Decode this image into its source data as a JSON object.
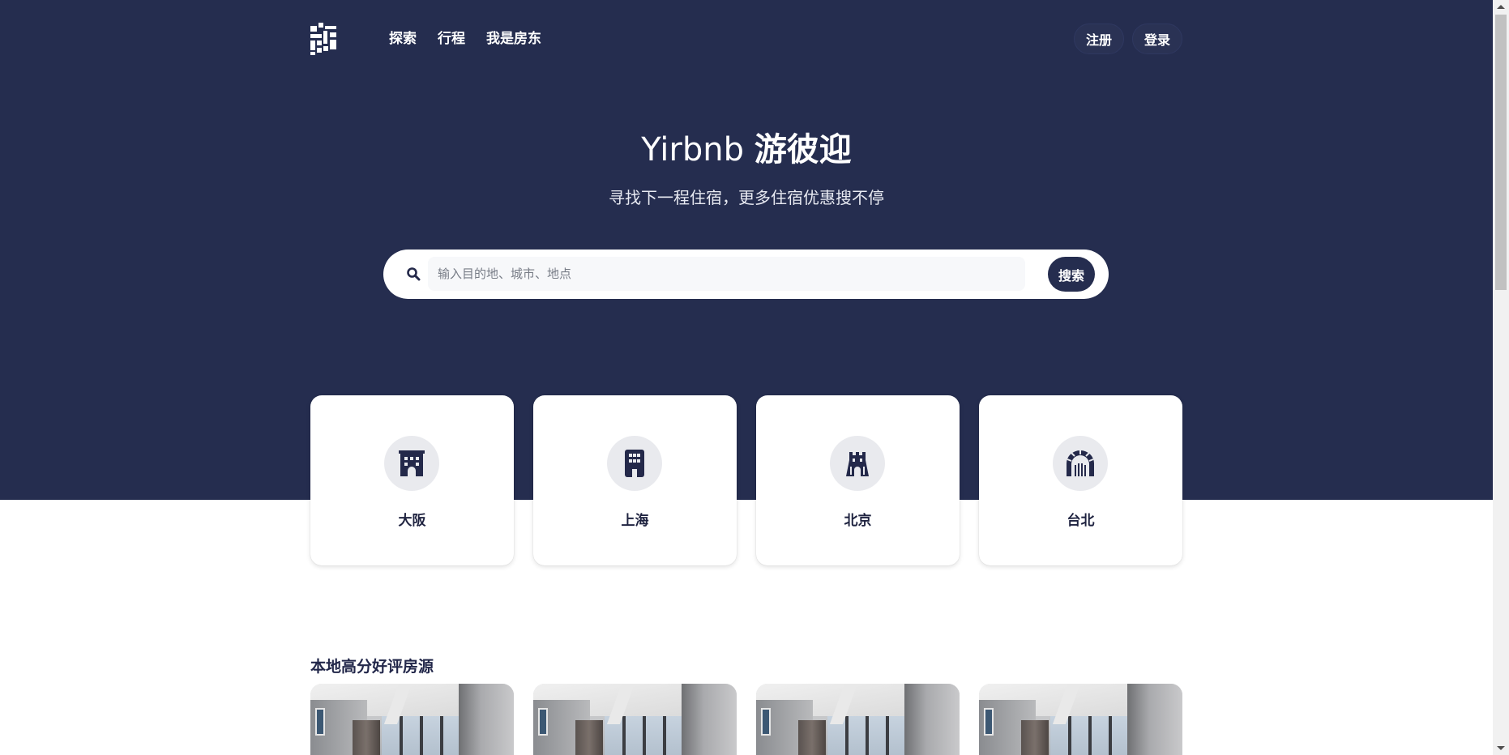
{
  "brand": {
    "logo": "logo-icon"
  },
  "nav": {
    "items": [
      {
        "label": "探索"
      },
      {
        "label": "行程"
      },
      {
        "label": "我是房东"
      }
    ]
  },
  "auth": {
    "register": "注册",
    "login": "登录"
  },
  "hero": {
    "title_brand": "Yirbnb",
    "title_cn": "游彼迎",
    "subtitle": "寻找下一程住宿，更多住宿优惠搜不停"
  },
  "search": {
    "icon": "search-icon",
    "placeholder": "输入目的地、城市、地点",
    "value": "",
    "button": "搜索"
  },
  "cities": [
    {
      "name": "大阪",
      "icon": "osaka-castle-icon"
    },
    {
      "name": "上海",
      "icon": "building-icon"
    },
    {
      "name": "北京",
      "icon": "gate-tower-icon"
    },
    {
      "name": "台北",
      "icon": "arch-gate-icon"
    }
  ],
  "section": {
    "title": "本地高分好评房源"
  },
  "colors": {
    "hero_bg": "#252d4f",
    "accent": "#252d4f",
    "card_icon_bg": "#e9eaee"
  }
}
